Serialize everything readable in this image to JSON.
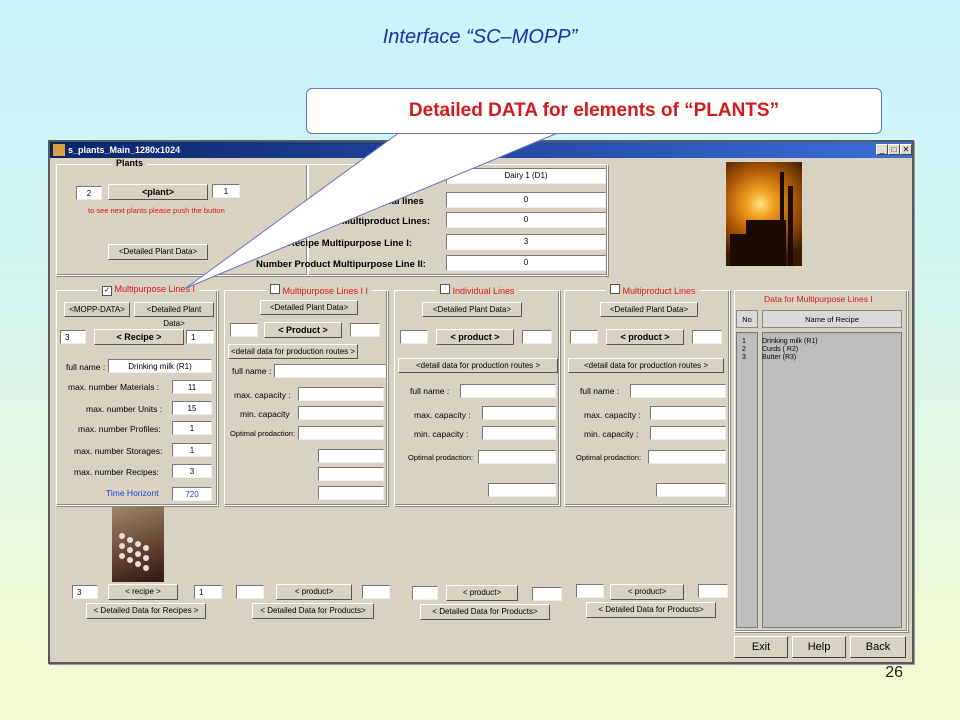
{
  "slide": {
    "title": "Interface “SC–MOPP”",
    "callout": "Detailed DATA for elements of “PLANTS”",
    "number": "26"
  },
  "window": {
    "title": "s_plants_Main_1280x1024"
  },
  "plants": {
    "title": "Plants",
    "left_value": "2",
    "button": "<plant>",
    "right_value": "1",
    "hint": "to see next plants please push the button",
    "detail_button": "<Detailed Plant Data>"
  },
  "summary": {
    "plant_name": "Dairy 1 (D1)",
    "rows": [
      {
        "label": "dual lines",
        "value": "0"
      },
      {
        "label": "Multiproduct Lines:",
        "value": "0"
      },
      {
        "label": "Recipe Multipurpose Line I:",
        "value": "3"
      },
      {
        "label": "Number Product Multipurpose Line II:",
        "value": "0"
      }
    ]
  },
  "mp1": {
    "title": "Multipurpose Lines I",
    "checked": "✓",
    "mopp_button": "<MOPP-DATA>",
    "detail_button": "<Detailed Plant Data>",
    "left_value": "3",
    "recipe_button": "< Recipe >",
    "right_value": "1",
    "full_name_label": "full name :",
    "full_name": "Drinking milk (R1)",
    "params": [
      {
        "label": "max. number Materials :",
        "value": "11"
      },
      {
        "label": "max. number Units :",
        "value": "15"
      },
      {
        "label": "max. number Profiles:",
        "value": "1"
      },
      {
        "label": "max. number Storages:",
        "value": "1"
      },
      {
        "label": "max. number Recipes:",
        "value": "3"
      }
    ],
    "time_label": "Time Horizont",
    "time_value": "720"
  },
  "mp2": {
    "title": "Multipurpose Lines I I",
    "detail_button": "<Detailed Plant Data>",
    "product_button": "< Product >",
    "routes_button": "<detail data for production routes >",
    "full_name_label": "full name :",
    "cap_max": "max. capacity :",
    "cap_min": "min. capacity",
    "optimal": "Optimal prodaction:"
  },
  "ind": {
    "title": "Individual Lines",
    "detail_button": "<Detailed Plant Data>",
    "product_button": "< product >",
    "routes_button": "<detail data for production routes >",
    "full_name_label": "full name :",
    "cap_max": "max. capacity :",
    "cap_min": "min. capacity :",
    "optimal": "Optimal prodaction:"
  },
  "mprod": {
    "title": "Multiproduct Lines",
    "detail_button": "<Detailed Plant Data>",
    "product_button": "< product >",
    "routes_button": "<detail data for production routes >",
    "full_name_label": "full name :",
    "cap_max": "max. capacity :",
    "cap_min": "min. capacity :",
    "optimal": "Optimal prodaction:"
  },
  "recipes_table": {
    "title": "Data for Multipurpose Lines I",
    "col_no": "No",
    "col_name": "Name of Recipe",
    "rows": [
      {
        "no": "1",
        "name": "Drinking milk (R1)"
      },
      {
        "no": "2",
        "name": "Curds ( R2)"
      },
      {
        "no": "3",
        "name": "Butter (R3)"
      }
    ]
  },
  "bottom": {
    "recipe_left": "3",
    "recipe_button": "< recipe >",
    "recipe_right": "1",
    "recipes_detail": "< Detailed Data for Recipes >",
    "product_button": "< product>",
    "products_detail": "< Detailed Data for Products>",
    "products_detail2": "< Detailed Data for Products>",
    "products_detail3": "< Detailed Data for Products>"
  },
  "actions": {
    "exit": "Exit",
    "help": "Help",
    "back": "Back"
  },
  "colors": {
    "title_blue": "#1c2ea8",
    "callout_red": "#d41a1a",
    "window_bg": "#d8d2c3",
    "titlebar": "#0a246a"
  }
}
